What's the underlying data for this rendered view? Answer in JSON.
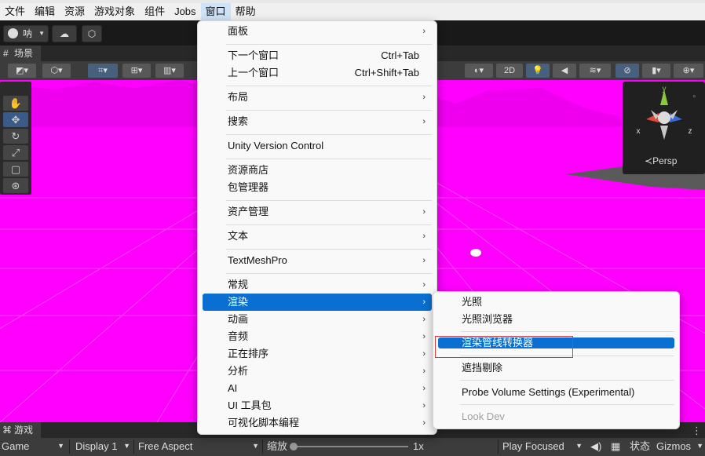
{
  "menubar": {
    "items": [
      {
        "label": "文件"
      },
      {
        "label": "编辑"
      },
      {
        "label": "资源"
      },
      {
        "label": "游戏对象"
      },
      {
        "label": "组件"
      },
      {
        "label": "Jobs"
      },
      {
        "label": "窗口"
      },
      {
        "label": "帮助"
      }
    ],
    "active": "窗口"
  },
  "toolbar": {
    "account_label": "呐",
    "account_icon": "user-icon",
    "cloud_icon": "cloud-icon",
    "collab_icon": "hexagon-icon"
  },
  "scene": {
    "tab_label": "场景",
    "toggle_2d": "2D",
    "persp_label": "Persp",
    "gizmo_axes": {
      "x": "x",
      "y": "y",
      "z": "z"
    }
  },
  "game": {
    "tab_label": "游戏",
    "view_select": "Game",
    "display_select": "Display 1",
    "aspect_select": "Free Aspect",
    "scale_label": "缩放",
    "scale_value": "1x",
    "play_mode_select": "Play Focused",
    "stats_label": "状态",
    "gizmos_label": "Gizmos"
  },
  "window_menu": {
    "items": [
      {
        "label": "面板",
        "submenu": true
      },
      {
        "label": "下一个窗口",
        "shortcut": "Ctrl+Tab"
      },
      {
        "label": "上一个窗口",
        "shortcut": "Ctrl+Shift+Tab"
      },
      {
        "label": "布局",
        "submenu": true
      },
      {
        "label": "搜索",
        "submenu": true
      },
      {
        "label": "Unity Version Control"
      },
      {
        "label": "资源商店"
      },
      {
        "label": "包管理器"
      },
      {
        "label": "资产管理",
        "submenu": true
      },
      {
        "label": "文本",
        "submenu": true
      },
      {
        "label": "TextMeshPro",
        "submenu": true
      },
      {
        "label": "常规",
        "submenu": true
      },
      {
        "label": "渲染",
        "submenu": true,
        "highlighted": true
      },
      {
        "label": "动画",
        "submenu": true
      },
      {
        "label": "音频",
        "submenu": true
      },
      {
        "label": "正在排序",
        "submenu": true
      },
      {
        "label": "分析",
        "submenu": true
      },
      {
        "label": "AI",
        "submenu": true
      },
      {
        "label": "UI 工具包",
        "submenu": true
      },
      {
        "label": "可视化脚本编程",
        "submenu": true
      }
    ]
  },
  "render_submenu": {
    "items": [
      {
        "label": "光照"
      },
      {
        "label": "光照浏览器"
      },
      {
        "label": "渲染管线转换器",
        "highlighted": true
      },
      {
        "label": "遮挡剔除"
      },
      {
        "label": "Probe Volume Settings (Experimental)"
      },
      {
        "label": "Look Dev",
        "disabled": true
      }
    ]
  },
  "colors": {
    "menu_highlight": "#0a6fd0",
    "scene_missing_material": "#ff00ff",
    "annotation_box": "#d63a3a",
    "editor_dark": "#3c3c3c"
  }
}
